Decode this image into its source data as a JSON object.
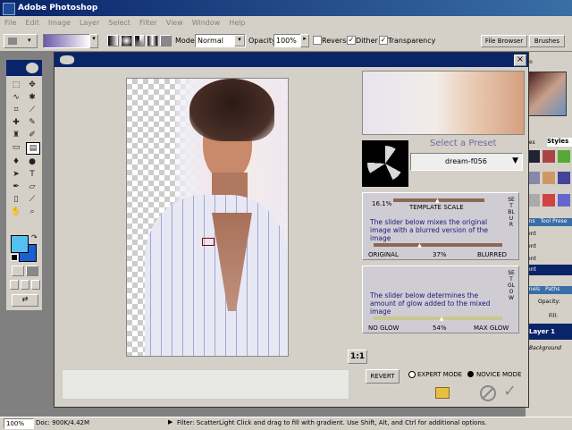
{
  "app": {
    "title": "Adobe Photoshop"
  },
  "menu": [
    "File",
    "Edit",
    "Image",
    "Layer",
    "Select",
    "Filter",
    "View",
    "Window",
    "Help"
  ],
  "options": {
    "mode_label": "Mode:",
    "mode_value": "Normal",
    "opacity_label": "Opacity:",
    "opacity_value": "100%",
    "reverse_label": "Reverse",
    "dither_label": "Dither",
    "transparency_label": "Transparency",
    "file_browser_tab": "File Browser",
    "brushes_tab": "Brushes"
  },
  "panels": {
    "info_tab": "fo",
    "swatches_tab": "hes",
    "styles_tab": "Styles",
    "history_tab": "ons",
    "tool_preset_tab": "Tool Prese",
    "r1": "ent",
    "r2": "ent",
    "r3": "ent",
    "r4": "ent",
    "channels_tab": "nnels",
    "paths_tab": "Paths",
    "opacity_label": "Opacity:",
    "fill_label": "Fill:",
    "layer1": "Layer 1",
    "background": "Background"
  },
  "dialog": {
    "close_glyph": "×",
    "select_preset_label": "Select a Preset",
    "preset_value": "dream-f056",
    "template_scale_value": "16.1%",
    "template_scale_label": "TEMPLATE SCALE",
    "set_blur": "SET BLUR",
    "blur_desc": "The slider below mixes the original image with a blurred version of the image",
    "blur_left": "ORIGINAL",
    "blur_value": "37%",
    "blur_right": "BLURRED",
    "set_glow": "SET GLOW",
    "glow_desc": "The slider below determines the amount of glow added to the mixed image",
    "glow_left": "NO GLOW",
    "glow_value": "54%",
    "glow_right": "MAX GLOW",
    "zoom_button": "1:1",
    "revert_button": "REVERT",
    "expert_mode": "EXPERT MODE",
    "novice_mode": "NOVICE MODE",
    "template_scale_fraction": 0.5,
    "blur_fraction": 0.37,
    "glow_fraction": 0.54
  },
  "status": {
    "zoom": "100%",
    "doc": "Doc: 900K/4.42M",
    "message": "Filter: ScatterLight  Click and drag to fill with gradient. Use Shift, Alt, and Ctrl for additional options."
  },
  "colors": {
    "titlebar": "#0a246a",
    "foreground": "#55c0f0",
    "background_swatch": "#1a60d0",
    "slider_brown": "#8a6a55",
    "slider_green": "#c8c890",
    "text_blue": "#1a1a7a"
  }
}
